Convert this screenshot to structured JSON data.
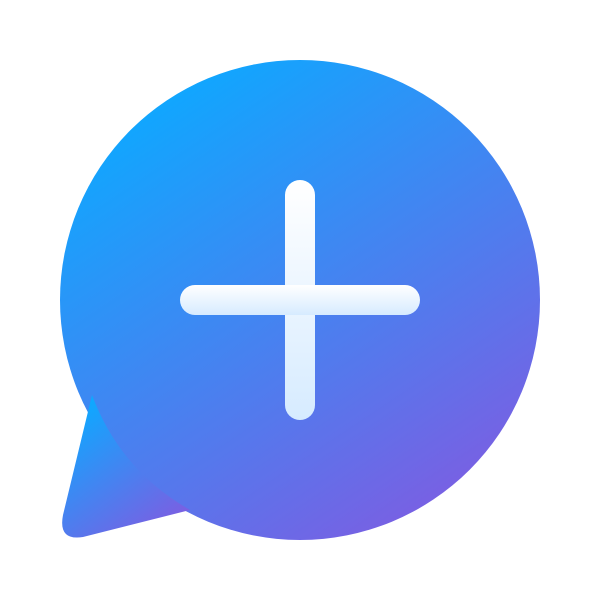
{
  "icon": {
    "name": "add-chat-bubble-icon",
    "bubble_gradient_start": "#0EA8FF",
    "bubble_gradient_end": "#7C5EE2",
    "plus_gradient_start": "#FFFFFF",
    "plus_gradient_end": "#D6EBFF"
  }
}
